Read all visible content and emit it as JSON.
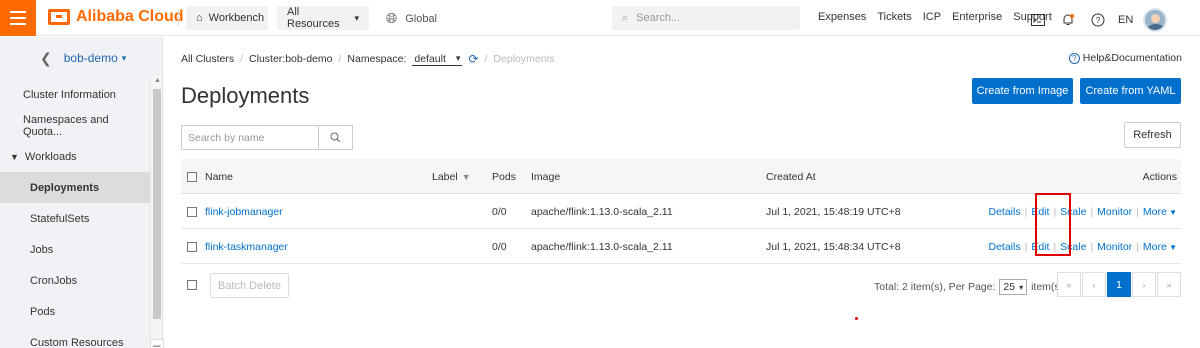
{
  "topbar": {
    "brand": "Alibaba Cloud",
    "workbench": "Workbench",
    "all_resources": "All Resources",
    "region": "Global",
    "search_placeholder": "Search...",
    "links": [
      "Expenses",
      "Tickets",
      "ICP",
      "Enterprise",
      "Support"
    ],
    "lang": "EN"
  },
  "sidebar": {
    "cluster_name": "bob-demo",
    "items": [
      {
        "label": "Cluster Information"
      },
      {
        "label": "Namespaces and Quota..."
      },
      {
        "label": "Workloads"
      },
      {
        "label": "Deployments"
      },
      {
        "label": "StatefulSets"
      },
      {
        "label": "Jobs"
      },
      {
        "label": "CronJobs"
      },
      {
        "label": "Pods"
      },
      {
        "label": "Custom Resources"
      }
    ]
  },
  "breadcrumb": {
    "all_clusters": "All Clusters",
    "cluster": "Cluster:bob-demo",
    "namespace_label": "Namespace:",
    "namespace_value": "default",
    "current": "Deployments"
  },
  "header": {
    "help": "Help&Documentation",
    "title": "Deployments",
    "create_from_image": "Create from Image",
    "create_from_yaml": "Create from YAML"
  },
  "toolbar": {
    "search_placeholder": "Search by name",
    "refresh": "Refresh"
  },
  "table": {
    "columns": {
      "name": "Name",
      "label": "Label",
      "pods": "Pods",
      "image": "Image",
      "created": "Created At",
      "actions": "Actions"
    },
    "rows": [
      {
        "name": "flink-jobmanager",
        "pods": "0/0",
        "image": "apache/flink:1.13.0-scala_2.11",
        "created": "Jul 1, 2021, 15:48:19 UTC+8"
      },
      {
        "name": "flink-taskmanager",
        "pods": "0/0",
        "image": "apache/flink:1.13.0-scala_2.11",
        "created": "Jul 1, 2021, 15:48:34 UTC+8"
      }
    ],
    "row_actions": {
      "details": "Details",
      "edit": "Edit",
      "scale": "Scale",
      "monitor": "Monitor",
      "more": "More"
    }
  },
  "footer": {
    "batch_delete": "Batch Delete",
    "total": "Total: 2 item(s), Per Page:",
    "per_page": "25",
    "items_suffix": "item(s)",
    "current_page": "1"
  },
  "colors": {
    "accent": "#ff6a00",
    "primary": "#0070cc",
    "highlight": "#e00000"
  }
}
